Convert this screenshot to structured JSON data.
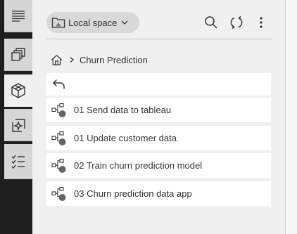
{
  "rail": {
    "items": [
      {
        "icon": "list-lines-icon"
      },
      {
        "icon": "stacked-windows-icon"
      },
      {
        "icon": "cube-icon",
        "active": true
      },
      {
        "icon": "sparkle-square-icon"
      },
      {
        "icon": "checklist-icon"
      }
    ]
  },
  "toolbar": {
    "space_label": "Local space",
    "search_icon": "search-icon",
    "sync_icon": "sync-icon",
    "more_icon": "more-vertical-icon"
  },
  "breadcrumb": {
    "current": "Churn Prediction"
  },
  "flows": [
    {
      "label": "01 Send data to tableau"
    },
    {
      "label": "01 Update customer data"
    },
    {
      "label": "02 Train churn prediction model"
    },
    {
      "label": "03 Churn prediction data app"
    }
  ],
  "colors": {
    "rail_dark": "#1e1e1e",
    "rail_item": "#d6d6d6",
    "background": "#f0f0f0",
    "row": "#ffffff"
  }
}
